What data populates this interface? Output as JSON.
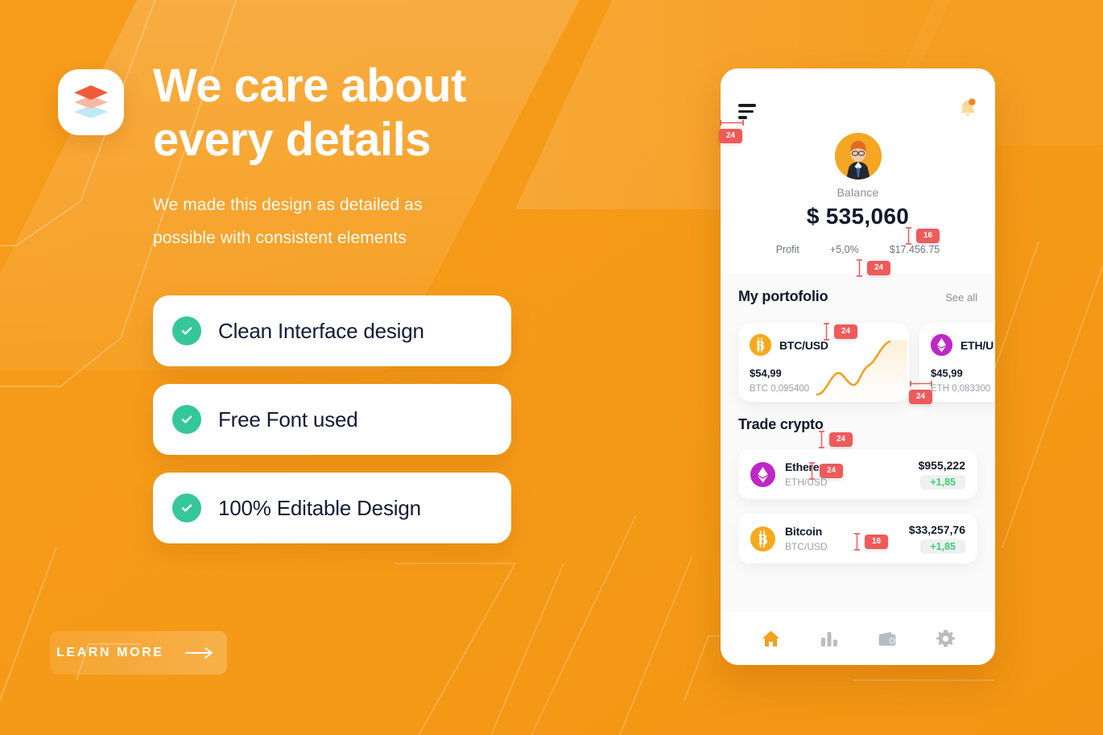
{
  "theme": {
    "bg_orange": "#f59a17",
    "bg_orange_light": "#f9b351",
    "accent_green": "#35c79a",
    "badge_red": "#ef5a5a",
    "text_dark": "#11182b",
    "gain_green": "#3ecf6d",
    "btc_orange": "#f7a91c",
    "eth_purple": "#c026c8"
  },
  "left": {
    "logo_icon": "layers-stack-icon",
    "headline_line1": "We care about",
    "headline_line2": "every details",
    "subhead_line1": "We made this design as detailed as",
    "subhead_line2": "possible with consistent elements",
    "features": [
      {
        "label": "Clean Interface design",
        "icon": "check-circle-icon"
      },
      {
        "label": "Free Font used",
        "icon": "check-circle-icon"
      },
      {
        "label": "100% Editable Design",
        "icon": "check-circle-icon"
      }
    ],
    "cta": {
      "label": "LEARN MORE",
      "icon": "arrow-right-icon"
    }
  },
  "phone": {
    "header": {
      "menu_icon": "hamburger-menu-icon",
      "bell_icon": "notification-bell-icon",
      "avatar_icon": "user-avatar"
    },
    "balance": {
      "label": "Balance",
      "amount": "$ 535,060",
      "profit_label": "Profit",
      "profit_percent": "+5,0%",
      "profit_value": "$17.456.75"
    },
    "portfolio": {
      "title": "My portofolio",
      "see_all": "See all",
      "cards": [
        {
          "pair": "BTC/USD",
          "price": "$54,99",
          "holding": "BTC 0,095400",
          "icon": "bitcoin-icon"
        },
        {
          "pair": "ETH/U",
          "price": "$45,99",
          "holding": "ETH 0,083300",
          "icon": "ethereum-icon"
        }
      ]
    },
    "trade": {
      "title": "Trade crypto",
      "rows": [
        {
          "name": "Ethereum",
          "pair": "ETH/USD",
          "price": "$955,222",
          "change": "+1,85",
          "icon": "ethereum-icon"
        },
        {
          "name": "Bitcoin",
          "pair": "BTC/USD",
          "price": "$33,257,76",
          "change": "+1,85",
          "icon": "bitcoin-icon"
        }
      ]
    },
    "tabbar": [
      {
        "icon": "home-icon",
        "active": true
      },
      {
        "icon": "bar-chart-icon",
        "active": false
      },
      {
        "icon": "wallet-icon",
        "active": false
      },
      {
        "icon": "gear-icon",
        "active": false
      }
    ]
  },
  "annotations": [
    {
      "id": "menu-width",
      "value": "24",
      "orientation": "horizontal"
    },
    {
      "id": "balance-gap",
      "value": "16",
      "orientation": "vertical"
    },
    {
      "id": "profit-gap",
      "value": "24",
      "orientation": "vertical"
    },
    {
      "id": "portfolio-gap",
      "value": "24",
      "orientation": "vertical"
    },
    {
      "id": "card-gap",
      "value": "24",
      "orientation": "horizontal"
    },
    {
      "id": "portfolio-below",
      "value": "24",
      "orientation": "vertical"
    },
    {
      "id": "trade-gap",
      "value": "24",
      "orientation": "vertical"
    },
    {
      "id": "row-gap",
      "value": "16",
      "orientation": "vertical"
    }
  ]
}
